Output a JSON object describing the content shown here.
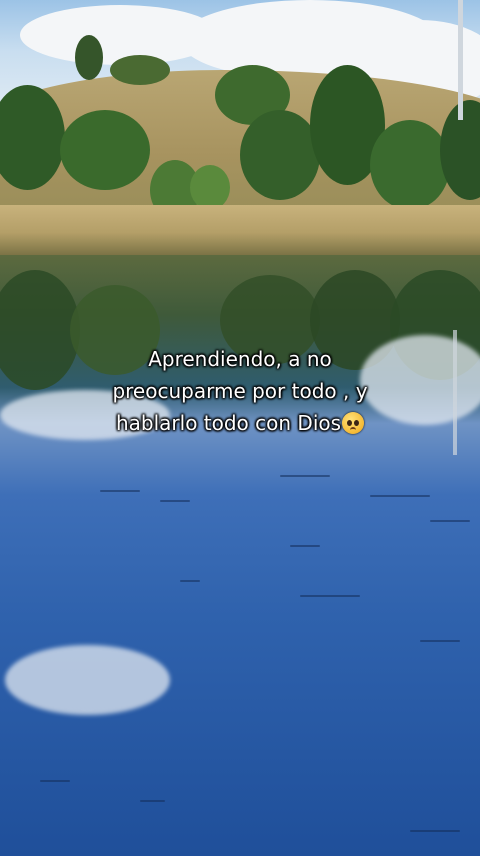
{
  "caption": {
    "line1": "Aprendiendo, a no",
    "line2": "preocuparme por todo , y",
    "line3": "hablarlo todo con Dios",
    "emoji": "pleading-face-emoji"
  },
  "scene": {
    "description_colors": {
      "sky": "#c9def0",
      "foliage": "#3f6b2e",
      "dry_grass": "#b9a673",
      "water": "#2f62ad"
    }
  }
}
